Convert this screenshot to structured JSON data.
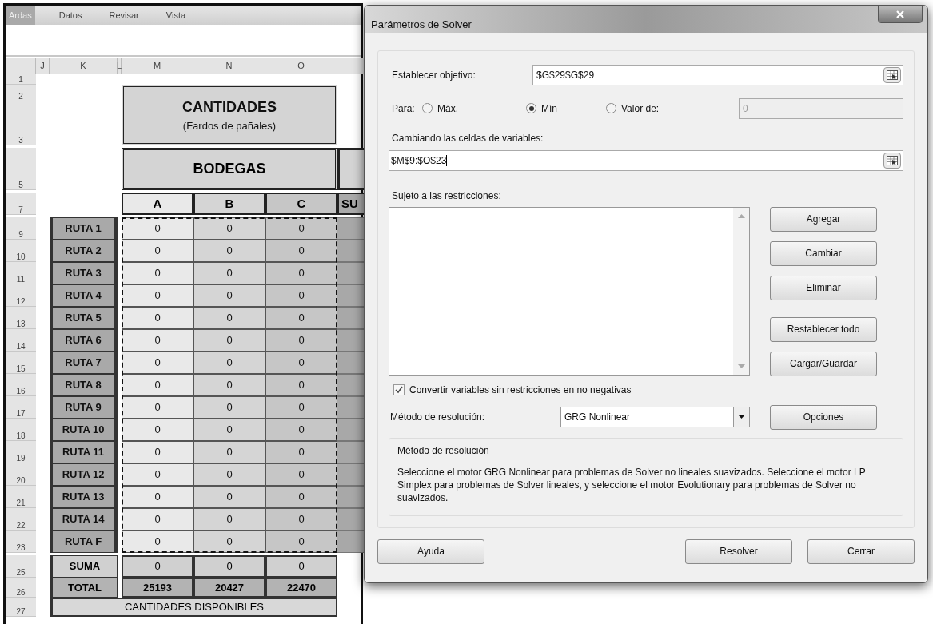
{
  "ribbon": {
    "tabs": [
      {
        "label": "Ardas",
        "selected": true
      },
      {
        "label": "Datos",
        "selected": false
      },
      {
        "label": "Revisar",
        "selected": false
      },
      {
        "label": "Vista",
        "selected": false
      }
    ]
  },
  "sheet": {
    "column_headers": [
      "J",
      "K",
      "L",
      "M",
      "N",
      "O"
    ],
    "row_headers": [
      "1",
      "2",
      "3",
      "5",
      "7",
      "9",
      "10",
      "11",
      "12",
      "13",
      "14",
      "15",
      "16",
      "17",
      "18",
      "19",
      "20",
      "21",
      "22",
      "23",
      "25",
      "26",
      "27"
    ],
    "title": "CANTIDADES",
    "subtitle": "(Fardos de pañales)",
    "group_header": "BODEGAS",
    "bodega_headers": [
      "A",
      "B",
      "C"
    ],
    "partial_header": "SU",
    "routes": [
      {
        "label": "RUTA 1",
        "values": [
          "0",
          "0",
          "0"
        ]
      },
      {
        "label": "RUTA 2",
        "values": [
          "0",
          "0",
          "0"
        ]
      },
      {
        "label": "RUTA 3",
        "values": [
          "0",
          "0",
          "0"
        ]
      },
      {
        "label": "RUTA 4",
        "values": [
          "0",
          "0",
          "0"
        ]
      },
      {
        "label": "RUTA 5",
        "values": [
          "0",
          "0",
          "0"
        ]
      },
      {
        "label": "RUTA 6",
        "values": [
          "0",
          "0",
          "0"
        ]
      },
      {
        "label": "RUTA 7",
        "values": [
          "0",
          "0",
          "0"
        ]
      },
      {
        "label": "RUTA 8",
        "values": [
          "0",
          "0",
          "0"
        ]
      },
      {
        "label": "RUTA 9",
        "values": [
          "0",
          "0",
          "0"
        ]
      },
      {
        "label": "RUTA 10",
        "values": [
          "0",
          "0",
          "0"
        ]
      },
      {
        "label": "RUTA 11",
        "values": [
          "0",
          "0",
          "0"
        ]
      },
      {
        "label": "RUTA 12",
        "values": [
          "0",
          "0",
          "0"
        ]
      },
      {
        "label": "RUTA 13",
        "values": [
          "0",
          "0",
          "0"
        ]
      },
      {
        "label": "RUTA 14",
        "values": [
          "0",
          "0",
          "0"
        ]
      },
      {
        "label": "RUTA F",
        "values": [
          "0",
          "0",
          "0"
        ]
      }
    ],
    "sum_row": {
      "label": "SUMA",
      "values": [
        "0",
        "0",
        "0"
      ]
    },
    "total_row": {
      "label": "TOTAL",
      "values": [
        "25193",
        "20427",
        "22470"
      ]
    },
    "footer": "CANTIDADES DISPONIBLES"
  },
  "dialog": {
    "title": "Parámetros de Solver",
    "objective": {
      "label": "Establecer objetivo:",
      "value": "$G$29$G$29"
    },
    "para": {
      "label": "Para:",
      "options": [
        {
          "label": "Máx.",
          "selected": false
        },
        {
          "label": "Mín",
          "selected": true
        },
        {
          "label": "Valor de:",
          "selected": false
        }
      ],
      "value_field": {
        "value": "0",
        "disabled": true
      }
    },
    "variables": {
      "label": "Cambiando las celdas de variables:",
      "value": "$M$9:$O$23"
    },
    "constraints": {
      "label": "Sujeto a las restricciones:"
    },
    "side_buttons": [
      "Agregar",
      "Cambiar",
      "Eliminar",
      "Restablecer todo",
      "Cargar/Guardar"
    ],
    "nonnegative": {
      "label": "Convertir variables sin restricciones en no negativas",
      "checked": true
    },
    "method": {
      "label": "Método de resolución:",
      "value": "GRG Nonlinear"
    },
    "options_button": "Opciones",
    "method_group": {
      "title": "Método de resolución",
      "text": "Seleccione el motor GRG Nonlinear para problemas de Solver no lineales suavizados. Seleccione el motor LP Simplex para problemas de Solver lineales, y seleccione el motor Evolutionary para problemas de Solver no suavizados."
    },
    "help_button": "Ayuda",
    "solve_button": "Resolver",
    "close_button": "Cerrar"
  }
}
